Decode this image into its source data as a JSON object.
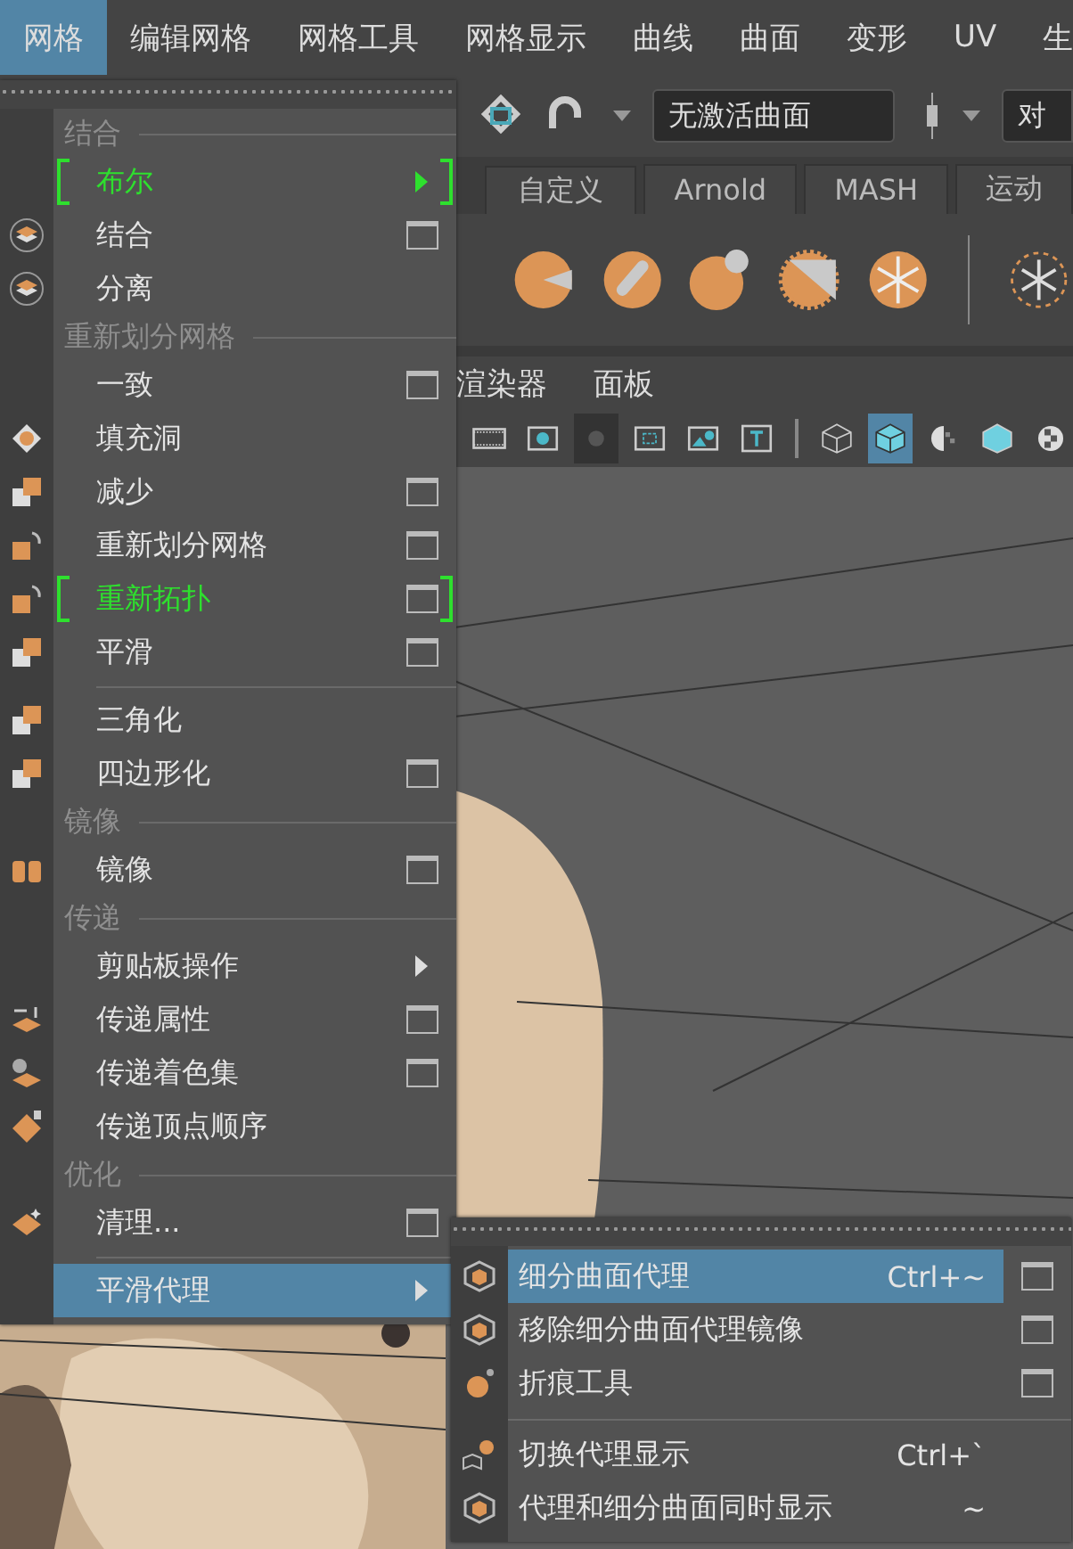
{
  "menubar": [
    {
      "label": "网格",
      "selected": true
    },
    {
      "label": "编辑网格",
      "selected": false
    },
    {
      "label": "网格工具",
      "selected": false
    },
    {
      "label": "网格显示",
      "selected": false
    },
    {
      "label": "曲线",
      "selected": false
    },
    {
      "label": "曲面",
      "selected": false
    },
    {
      "label": "变形",
      "selected": false
    },
    {
      "label": "UV",
      "selected": false
    },
    {
      "label": "生",
      "selected": false
    }
  ],
  "status_line": {
    "surface_field": "无激活曲面",
    "symmetry_field": "对"
  },
  "shelf_tabs": [
    "自定义",
    "Arnold",
    "MASH",
    "运动"
  ],
  "panel_menu": [
    "渲染器",
    "面板"
  ],
  "main_menu": {
    "items": [
      {
        "kind": "header",
        "label": "结合"
      },
      {
        "kind": "item",
        "label": "布尔",
        "marked": true,
        "submenu": true,
        "option_box": false,
        "selected": false
      },
      {
        "kind": "item",
        "label": "结合",
        "marked": false,
        "submenu": false,
        "option_box": true,
        "selected": false
      },
      {
        "kind": "item",
        "label": "分离",
        "marked": false,
        "submenu": false,
        "option_box": false,
        "selected": false
      },
      {
        "kind": "header",
        "label": "重新划分网格"
      },
      {
        "kind": "item",
        "label": "一致",
        "marked": false,
        "submenu": false,
        "option_box": true,
        "selected": false
      },
      {
        "kind": "item",
        "label": "填充洞",
        "marked": false,
        "submenu": false,
        "option_box": false,
        "selected": false
      },
      {
        "kind": "item",
        "label": "减少",
        "marked": false,
        "submenu": false,
        "option_box": true,
        "selected": false
      },
      {
        "kind": "item",
        "label": "重新划分网格",
        "marked": false,
        "submenu": false,
        "option_box": true,
        "selected": false
      },
      {
        "kind": "item",
        "label": "重新拓扑",
        "marked": true,
        "submenu": false,
        "option_box": true,
        "selected": false
      },
      {
        "kind": "item",
        "label": "平滑",
        "marked": false,
        "submenu": false,
        "option_box": true,
        "selected": false
      },
      {
        "kind": "separator"
      },
      {
        "kind": "item",
        "label": "三角化",
        "marked": false,
        "submenu": false,
        "option_box": false,
        "selected": false
      },
      {
        "kind": "item",
        "label": "四边形化",
        "marked": false,
        "submenu": false,
        "option_box": true,
        "selected": false
      },
      {
        "kind": "header",
        "label": "镜像"
      },
      {
        "kind": "item",
        "label": "镜像",
        "marked": false,
        "submenu": false,
        "option_box": true,
        "selected": false
      },
      {
        "kind": "header",
        "label": "传递"
      },
      {
        "kind": "item",
        "label": "剪贴板操作",
        "marked": false,
        "submenu": true,
        "option_box": false,
        "selected": false
      },
      {
        "kind": "item",
        "label": "传递属性",
        "marked": false,
        "submenu": false,
        "option_box": true,
        "selected": false
      },
      {
        "kind": "item",
        "label": "传递着色集",
        "marked": false,
        "submenu": false,
        "option_box": true,
        "selected": false
      },
      {
        "kind": "item",
        "label": "传递顶点顺序",
        "marked": false,
        "submenu": false,
        "option_box": false,
        "selected": false
      },
      {
        "kind": "header",
        "label": "优化"
      },
      {
        "kind": "item",
        "label": "清理...",
        "marked": false,
        "submenu": false,
        "option_box": true,
        "selected": false
      },
      {
        "kind": "separator"
      },
      {
        "kind": "item",
        "label": "平滑代理",
        "marked": false,
        "submenu": true,
        "option_box": false,
        "selected": true
      }
    ]
  },
  "submenu": {
    "items": [
      {
        "kind": "item",
        "label": "细分曲面代理",
        "shortcut": "Ctrl+~",
        "option_box": true,
        "selected": true
      },
      {
        "kind": "item",
        "label": "移除细分曲面代理镜像",
        "option_box": true,
        "selected": false
      },
      {
        "kind": "item",
        "label": "折痕工具",
        "option_box": true,
        "selected": false
      },
      {
        "kind": "separator"
      },
      {
        "kind": "item",
        "label": "切换代理显示",
        "shortcut": "Ctrl+`",
        "option_box": false,
        "selected": false
      },
      {
        "kind": "item",
        "label": "代理和细分曲面同时显示",
        "shortcut": "~",
        "option_box": false,
        "selected": false
      }
    ]
  }
}
